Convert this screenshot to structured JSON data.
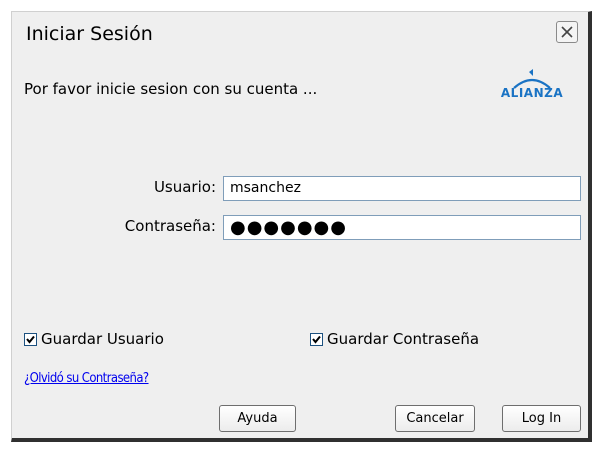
{
  "dialog": {
    "title": "Iniciar Sesión",
    "subtitle": "Por favor inicie sesion con su cuenta ...",
    "logo_text": "ALIANZA",
    "close_symbol": "✕"
  },
  "form": {
    "username_label": "Usuario:",
    "username_value": "msanchez",
    "password_label": "Contraseña:",
    "password_value": "●●●●●●●"
  },
  "options": {
    "save_user_label": "Guardar Usuario",
    "save_user_checked": true,
    "save_password_label": "Guardar Contraseña",
    "save_password_checked": true
  },
  "links": {
    "forgot_password": "¿Olvidó su Contraseña?"
  },
  "buttons": {
    "help": "Ayuda",
    "cancel": "Cancelar",
    "login": "Log In"
  },
  "colors": {
    "dialog_bg": "#efefef",
    "link": "#0000ee",
    "logo": "#1a73c4"
  }
}
